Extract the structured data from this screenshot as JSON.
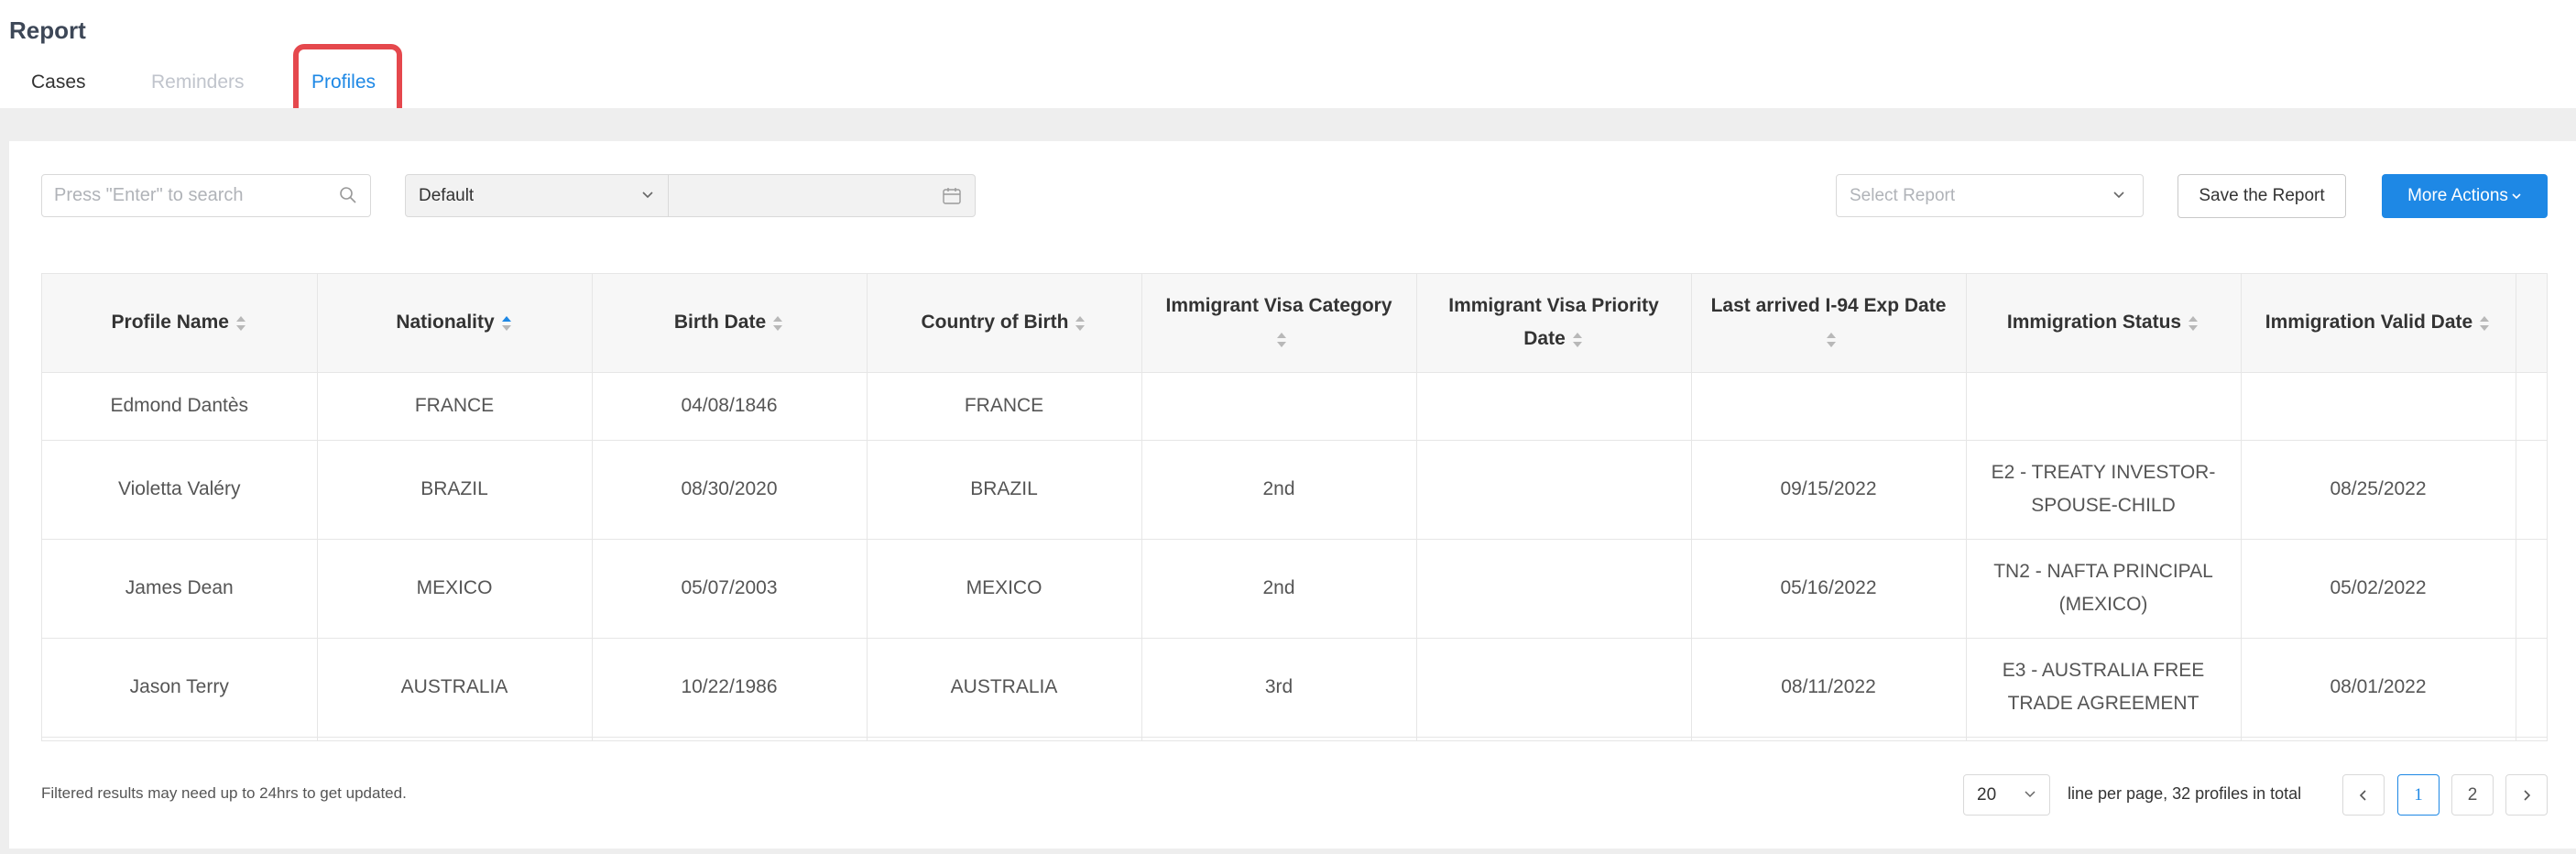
{
  "page": {
    "title": "Report"
  },
  "tabs": [
    {
      "label": "Cases",
      "active": false
    },
    {
      "label": "Reminders",
      "active": false
    },
    {
      "label": "Profiles",
      "active": true
    }
  ],
  "toolbar": {
    "search_placeholder": "Press \"Enter\" to search",
    "date_filter_value": "Default",
    "report_select_placeholder": "Select Report",
    "save_label": "Save the Report",
    "more_label": "More Actions"
  },
  "table": {
    "columns": [
      {
        "l1": "Profile Name",
        "l2": "",
        "sort": "none"
      },
      {
        "l1": "Nationality",
        "l2": "",
        "sort": "asc"
      },
      {
        "l1": "Birth Date",
        "l2": "",
        "sort": "none"
      },
      {
        "l1": "Country of Birth",
        "l2": "",
        "sort": "none"
      },
      {
        "l1": "Immigrant Visa Category",
        "l2": "",
        "sort": "none"
      },
      {
        "l1": "Immigrant Visa Priority",
        "l2": "Date",
        "sort": "none"
      },
      {
        "l1": "Last arrived I-94 Exp Date",
        "l2": "",
        "sort": "none"
      },
      {
        "l1": "Immigration Status",
        "l2": "",
        "sort": "none"
      },
      {
        "l1": "Immigration Valid Date",
        "l2": "",
        "sort": "none"
      }
    ],
    "rows": [
      {
        "cells": [
          "Edmond Dantès",
          "FRANCE",
          "04/08/1846",
          "FRANCE",
          "",
          "",
          "",
          "",
          ""
        ]
      },
      {
        "cells": [
          "Violetta Valéry",
          "BRAZIL",
          "08/30/2020",
          "BRAZIL",
          "2nd",
          "",
          "09/15/2022",
          "E2 - TREATY INVESTOR-SPOUSE-CHILD",
          "08/25/2022"
        ]
      },
      {
        "cells": [
          "James Dean",
          "MEXICO",
          "05/07/2003",
          "MEXICO",
          "2nd",
          "",
          "05/16/2022",
          "TN2 - NAFTA PRINCIPAL (MEXICO)",
          "05/02/2022"
        ]
      },
      {
        "cells": [
          "Jason Terry",
          "AUSTRALIA",
          "10/22/1986",
          "AUSTRALIA",
          "3rd",
          "",
          "08/11/2022",
          "E3 - AUSTRALIA FREE TRADE AGREEMENT",
          "08/01/2022"
        ]
      }
    ]
  },
  "footer": {
    "note": "Filtered results may need up to 24hrs to get updated.",
    "page_size": "20",
    "total_text": "line per page, 32 profiles in total",
    "pages": [
      "1",
      "2"
    ],
    "current_page": "1"
  },
  "colors": {
    "accent": "#1e88e5",
    "highlight": "#e5484d"
  }
}
